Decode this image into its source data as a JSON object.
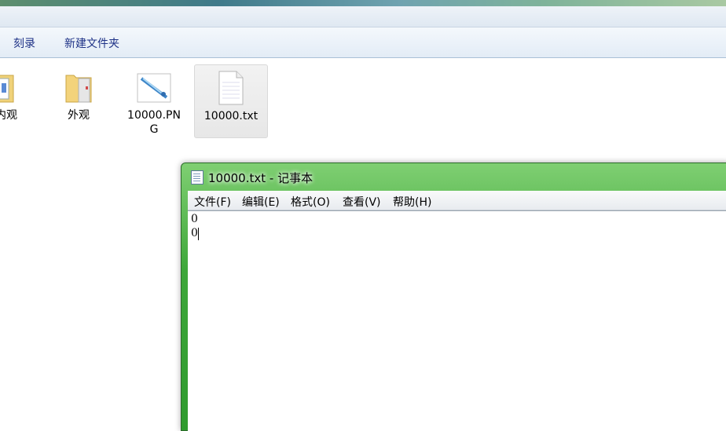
{
  "toolbar": {
    "burn_label": "刻录",
    "new_folder_label": "新建文件夹"
  },
  "files": [
    {
      "label": "本内观",
      "icon": "folder-with-images-icon"
    },
    {
      "label": "外观",
      "icon": "folder-icon"
    },
    {
      "label": "10000.PN\nG",
      "icon": "image-file-icon"
    },
    {
      "label": "10000.txt",
      "icon": "text-file-icon",
      "selected": true
    }
  ],
  "notepad": {
    "title": "10000.txt - 记事本",
    "menus": [
      "文件(F)",
      "编辑(E)",
      "格式(O)",
      "查看(V)",
      "帮助(H)"
    ],
    "lines": [
      "0",
      "0"
    ]
  },
  "colors": {
    "toolbar_text": "#1e3287",
    "window_frame": "#3ea73a"
  }
}
